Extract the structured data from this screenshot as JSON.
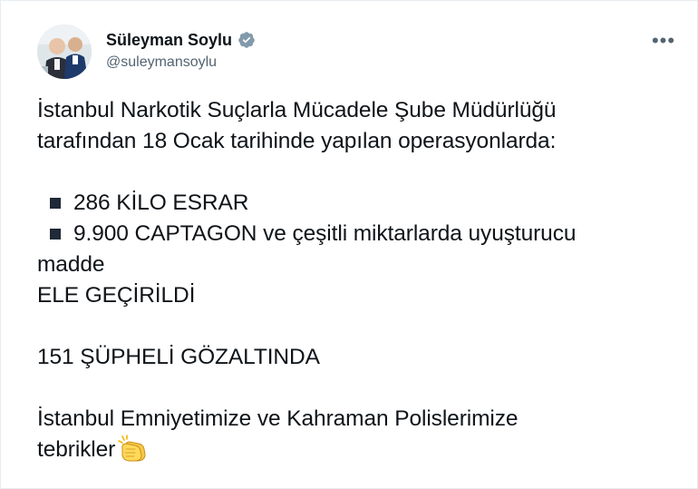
{
  "tweet": {
    "author": {
      "display_name": "Süleyman Soylu",
      "handle": "@suleymansoylu",
      "verified": true
    },
    "more_icon": "more-horizontal-icon",
    "text": {
      "line1": "İstanbul Narkotik Suçlarla Mücadele Şube Müdürlüğü",
      "line2": "tarafından 18 Ocak tarihinde yapılan operasyonlarda:",
      "bullet1": "286 KİLO ESRAR",
      "bullet2": "9.900 CAPTAGON ve çeşitli miktarlarda uyuşturucu",
      "line_madde": "madde",
      "line_ele": "ELE GEÇİRİLDİ",
      "line_suspects": "151 ŞÜPHELİ GÖZALTINDA",
      "line_thanks1": "İstanbul Emniyetimize ve Kahraman Polislerimize",
      "line_thanks2": "tebrikler"
    },
    "emoji": "clapping-hands-icon",
    "colors": {
      "verified_badge": "#829aab",
      "handle": "#536471",
      "text": "#0f1419"
    }
  }
}
